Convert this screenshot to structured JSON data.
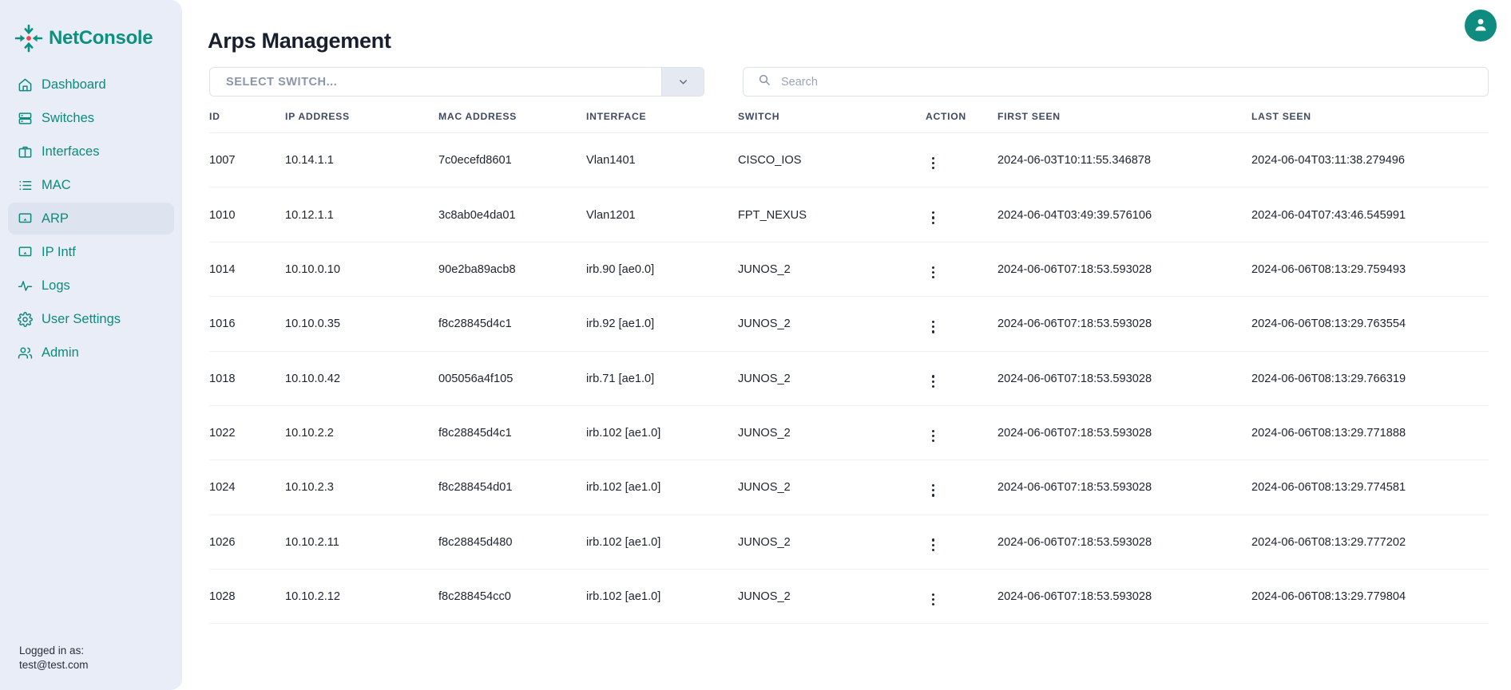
{
  "brand": {
    "name": "NetConsole",
    "logo_icon": "converge-arrows-icon",
    "accent": "#0e9080"
  },
  "sidebar": {
    "items": [
      {
        "label": "Dashboard",
        "icon": "home-icon",
        "active": false
      },
      {
        "label": "Switches",
        "icon": "server-icon",
        "active": false
      },
      {
        "label": "Interfaces",
        "icon": "briefcase-icon",
        "active": false
      },
      {
        "label": "MAC",
        "icon": "list-icon",
        "active": false
      },
      {
        "label": "ARP",
        "icon": "monitor-icon",
        "active": true
      },
      {
        "label": "IP Intf",
        "icon": "monitor-icon",
        "active": false
      },
      {
        "label": "Logs",
        "icon": "activity-icon",
        "active": false
      },
      {
        "label": "User Settings",
        "icon": "gear-icon",
        "active": false
      },
      {
        "label": "Admin",
        "icon": "users-icon",
        "active": false
      }
    ],
    "footer": {
      "logged_in_label": "Logged in as:",
      "user_email": "test@test.com"
    }
  },
  "header": {
    "page_title": "Arps Management",
    "avatar_icon": "user-avatar-icon",
    "avatar_bg": "#0e8c80"
  },
  "controls": {
    "switch_select": {
      "value": "SELECT SWITCH...",
      "chevron_icon": "chevron-down-icon"
    },
    "search": {
      "value": "",
      "placeholder": "Search",
      "icon": "search-icon"
    }
  },
  "table": {
    "columns": [
      "ID",
      "IP ADDRESS",
      "MAC ADDRESS",
      "INTERFACE",
      "SWITCH",
      "ACTION",
      "FIRST SEEN",
      "LAST SEEN"
    ],
    "action_icon": "kebab-menu-icon",
    "rows": [
      {
        "id": "1007",
        "ip": "10.14.1.1",
        "mac": "7c0ecefd8601",
        "interface": "Vlan1401",
        "switch": "CISCO_IOS",
        "first_seen": "2024-06-03T10:11:55.346878",
        "last_seen": "2024-06-04T03:11:38.279496"
      },
      {
        "id": "1010",
        "ip": "10.12.1.1",
        "mac": "3c8ab0e4da01",
        "interface": "Vlan1201",
        "switch": "FPT_NEXUS",
        "first_seen": "2024-06-04T03:49:39.576106",
        "last_seen": "2024-06-04T07:43:46.545991"
      },
      {
        "id": "1014",
        "ip": "10.10.0.10",
        "mac": "90e2ba89acb8",
        "interface": "irb.90 [ae0.0]",
        "switch": "JUNOS_2",
        "first_seen": "2024-06-06T07:18:53.593028",
        "last_seen": "2024-06-06T08:13:29.759493"
      },
      {
        "id": "1016",
        "ip": "10.10.0.35",
        "mac": "f8c28845d4c1",
        "interface": "irb.92 [ae1.0]",
        "switch": "JUNOS_2",
        "first_seen": "2024-06-06T07:18:53.593028",
        "last_seen": "2024-06-06T08:13:29.763554"
      },
      {
        "id": "1018",
        "ip": "10.10.0.42",
        "mac": "005056a4f105",
        "interface": "irb.71 [ae1.0]",
        "switch": "JUNOS_2",
        "first_seen": "2024-06-06T07:18:53.593028",
        "last_seen": "2024-06-06T08:13:29.766319"
      },
      {
        "id": "1022",
        "ip": "10.10.2.2",
        "mac": "f8c28845d4c1",
        "interface": "irb.102 [ae1.0]",
        "switch": "JUNOS_2",
        "first_seen": "2024-06-06T07:18:53.593028",
        "last_seen": "2024-06-06T08:13:29.771888"
      },
      {
        "id": "1024",
        "ip": "10.10.2.3",
        "mac": "f8c288454d01",
        "interface": "irb.102 [ae1.0]",
        "switch": "JUNOS_2",
        "first_seen": "2024-06-06T07:18:53.593028",
        "last_seen": "2024-06-06T08:13:29.774581"
      },
      {
        "id": "1026",
        "ip": "10.10.2.11",
        "mac": "f8c28845d480",
        "interface": "irb.102 [ae1.0]",
        "switch": "JUNOS_2",
        "first_seen": "2024-06-06T07:18:53.593028",
        "last_seen": "2024-06-06T08:13:29.777202"
      },
      {
        "id": "1028",
        "ip": "10.10.2.12",
        "mac": "f8c288454cc0",
        "interface": "irb.102 [ae1.0]",
        "switch": "JUNOS_2",
        "first_seen": "2024-06-06T07:18:53.593028",
        "last_seen": "2024-06-06T08:13:29.779804"
      }
    ]
  }
}
